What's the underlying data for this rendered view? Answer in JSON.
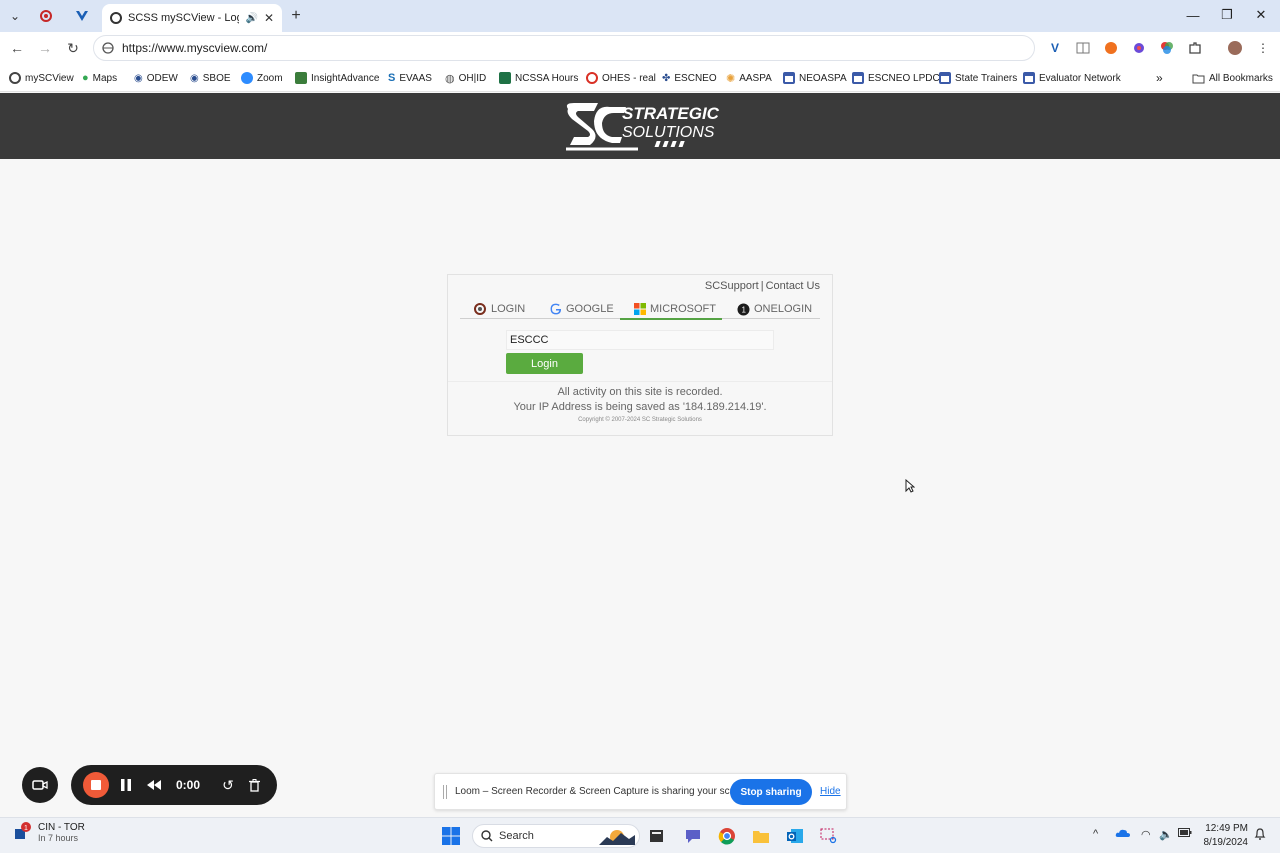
{
  "browser": {
    "active_tab_title": "SCSS mySCView - Login",
    "url": "https://www.myscview.com/",
    "bookmarks": [
      {
        "label": "mySCView",
        "color": "#444444"
      },
      {
        "label": "Maps",
        "color": "#34a853"
      },
      {
        "label": "ODEW",
        "color": "#2a4d8f"
      },
      {
        "label": "SBOE",
        "color": "#2a4d8f"
      },
      {
        "label": "Zoom",
        "color": "#2d8cff"
      },
      {
        "label": "InsightAdvance",
        "color": "#3b7d3b"
      },
      {
        "label": "EVAAS",
        "color": "#1b6fb5"
      },
      {
        "label": "OH|ID",
        "color": "#555555"
      },
      {
        "label": "NCSSA Hours",
        "color": "#1e7145"
      },
      {
        "label": "OHES - real",
        "color": "#d93025"
      },
      {
        "label": "ESCNEO",
        "color": "#2a4d8f"
      },
      {
        "label": "AASPA",
        "color": "#e8a13a"
      },
      {
        "label": "NEOASPA",
        "color": "#3b5aa8"
      },
      {
        "label": "ESCNEO LPDC",
        "color": "#3b5aa8"
      },
      {
        "label": "State Trainers",
        "color": "#3b5aa8"
      },
      {
        "label": "Evaluator Network",
        "color": "#3b5aa8"
      }
    ],
    "all_bookmarks_label": "All Bookmarks"
  },
  "site": {
    "logo_text_1": "STRATEGIC",
    "logo_text_2": "SOLUTIONS",
    "header_color": "#3a3a3a"
  },
  "login": {
    "support_link": "SCSupport",
    "separator": "|",
    "contact_link": "Contact Us",
    "tabs": [
      {
        "label": "LOGIN",
        "icon": "search-icon"
      },
      {
        "label": "GOOGLE",
        "icon": "google-icon"
      },
      {
        "label": "MICROSOFT",
        "icon": "microsoft-icon",
        "active": true
      },
      {
        "label": "ONELOGIN",
        "icon": "onelogin-icon"
      }
    ],
    "username_value": "ESCCC",
    "login_button": "Login",
    "notice_1": "All activity on this site is recorded.",
    "notice_2": "Your IP Address is being saved as '184.189.214.19'.",
    "copyright": "Copyright © 2007-2024 SC Strategic Solutions",
    "accent": "#5aab3f"
  },
  "loom": {
    "timer": "0:00",
    "share_message": "Loom – Screen Recorder & Screen Capture is sharing your screen.",
    "stop_label": "Stop sharing",
    "hide_label": "Hide"
  },
  "taskbar": {
    "weather_title": "CIN - TOR",
    "weather_sub": "In 7 hours",
    "search_placeholder": "Search",
    "time": "12:49 PM",
    "date": "8/19/2024"
  }
}
